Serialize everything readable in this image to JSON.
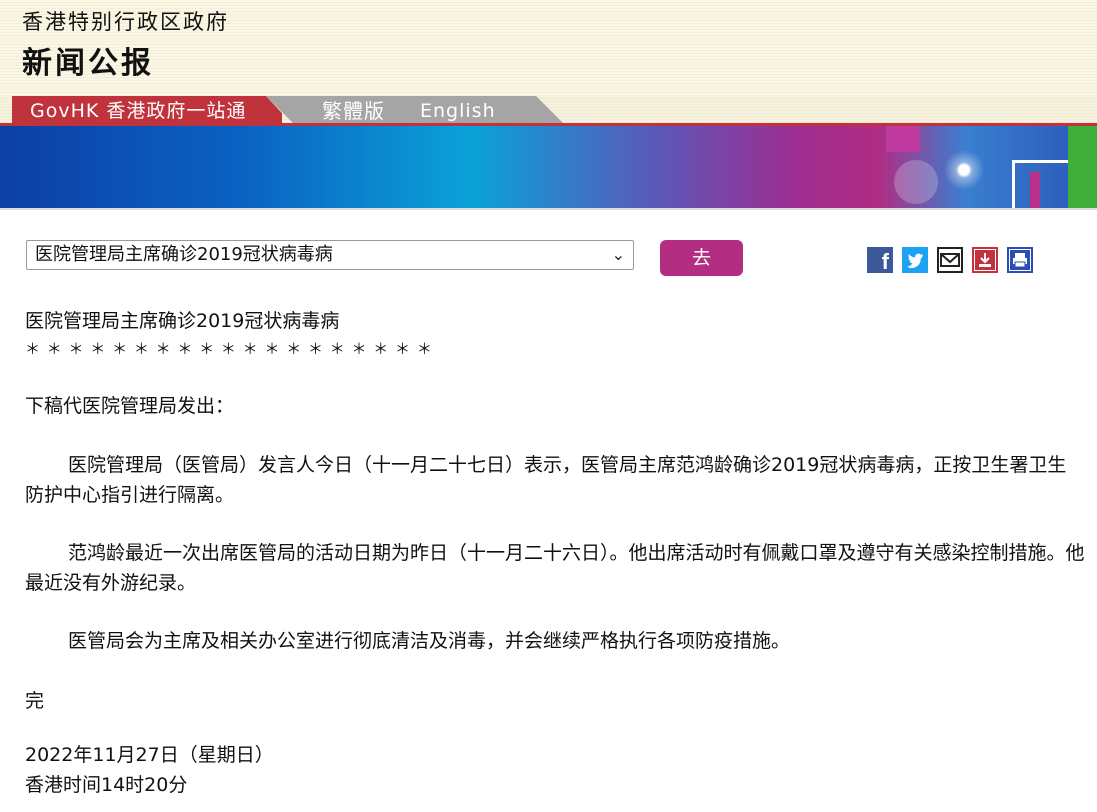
{
  "header": {
    "gov_name": "香港特别行政区政府",
    "news_title": "新闻公报"
  },
  "nav": {
    "govhk": "GovHK 香港政府一站通",
    "traditional": "繁體版",
    "english": "English"
  },
  "toolbar": {
    "select_value": "医院管理局主席确诊2019冠状病毒病",
    "go_label": "去",
    "share_icons": [
      "facebook-icon",
      "twitter-icon",
      "email-icon",
      "save-icon",
      "print-icon"
    ]
  },
  "article": {
    "title": "医院管理局主席确诊2019冠状病毒病",
    "stars": "＊ ＊ ＊ ＊ ＊ ＊ ＊ ＊ ＊ ＊ ＊ ＊ ＊ ＊ ＊ ＊ ＊ ＊ ＊",
    "intro": "下稿代医院管理局发出：",
    "para1": "医院管理局（医管局）发言人今日（十一月二十七日）表示，医管局主席范鸿龄确诊2019冠状病毒病，正按卫生署卫生防护中心指引进行隔离。",
    "para2": "范鸿龄最近一次出席医管局的活动日期为昨日（十一月二十六日）。他出席活动时有佩戴口罩及遵守有关感染控制措施。他最近没有外游纪录。",
    "para3": "医管局会为主席及相关办公室进行彻底清洁及消毒，并会继续严格执行各项防疫措施。",
    "end": "完",
    "date": "2022年11月27日（星期日）",
    "time": "香港时间14时20分"
  },
  "colors": {
    "accent_red": "#c0333c",
    "button_magenta": "#b32d82",
    "header_bg": "#fbf7e4"
  }
}
